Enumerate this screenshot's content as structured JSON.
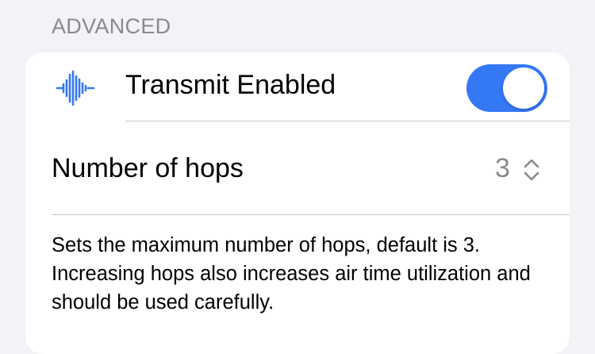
{
  "section": {
    "header": "ADVANCED"
  },
  "transmit": {
    "icon": "waveform-icon",
    "label": "Transmit Enabled",
    "enabled": true,
    "toggle_color": "#3478f6"
  },
  "hops": {
    "label": "Number of hops",
    "value": "3",
    "icon": "chevron-up-down-icon"
  },
  "footer": {
    "text": "Sets the maximum number of hops, default is 3. Increasing hops also increases air time utilization and should be used carefully."
  }
}
